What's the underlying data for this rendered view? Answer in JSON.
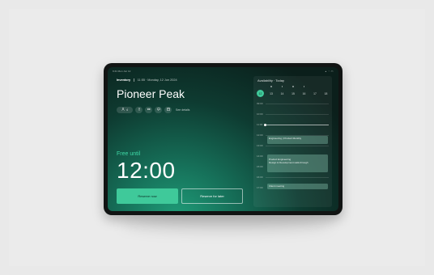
{
  "status_bar": {
    "time": "9:41 Mon Jun 12",
    "icons": "▴ ◔ ▭"
  },
  "header": {
    "brand": "Inventory",
    "datetime": "11:55 · Monday, 12 Jun 2024"
  },
  "room": {
    "name": "Pioneer Peak",
    "capacity": "4",
    "see_details": "See details"
  },
  "status": {
    "label": "Free until",
    "time": "12:00"
  },
  "actions": {
    "reserve_now": "Reserve now",
    "reserve_later": "Reserve for later"
  },
  "availability": {
    "title": "Availability · Today",
    "days": [
      "12",
      "13",
      "14",
      "15",
      "16",
      "17",
      "18"
    ],
    "active_day_index": 0,
    "times": [
      "09:00",
      "10:00",
      "11:00",
      "12:00",
      "13:00",
      "14:00",
      "15:00",
      "16:00",
      "17:00"
    ],
    "events": [
      {
        "title": "Engineering | Product Monthly"
      },
      {
        "title": "Product Engineering\nDesign & Development walk-through"
      },
      {
        "title": "Client meeting"
      }
    ]
  },
  "colors": {
    "accent": "#3fc99a",
    "screen_bg": "#0b1f1b"
  },
  "icons": [
    "person-icon",
    "accessibility-icon",
    "video-icon",
    "chat-icon",
    "calendar-icon"
  ]
}
